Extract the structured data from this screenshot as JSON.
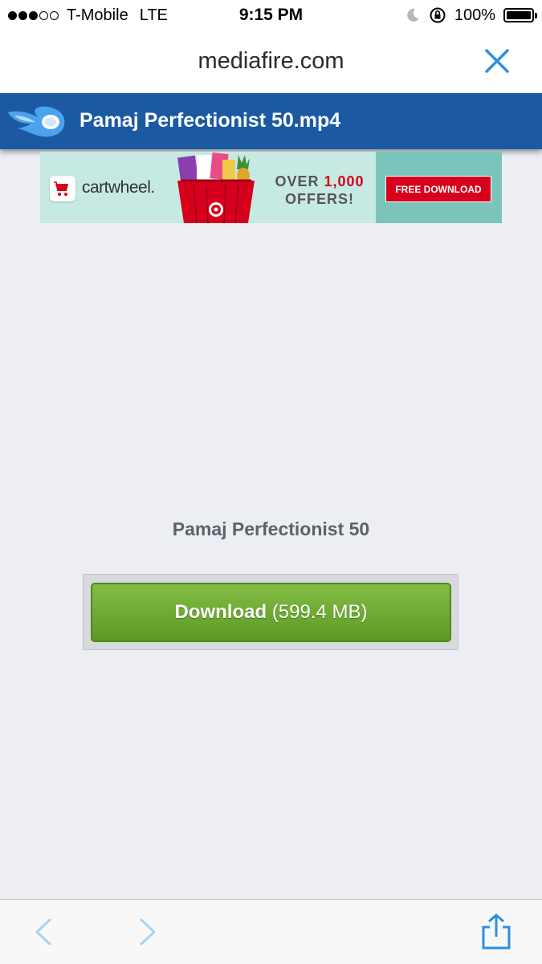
{
  "status_bar": {
    "carrier": "T-Mobile",
    "network": "LTE",
    "time": "9:15 PM",
    "battery": "100%",
    "signal_bars_filled": 3,
    "signal_bars_total": 5
  },
  "browser": {
    "url": "mediafire.com",
    "close_icon": "close-icon"
  },
  "header": {
    "logo_icon": "mediafire-logo-icon",
    "title": "Pamaj Perfectionist 50.mp4",
    "color": "#1b5aa3"
  },
  "ad": {
    "brand": "cartwheel.",
    "offer_line1_prefix": "OVER",
    "offer_line1_number": "1,000",
    "offer_line2": "OFFERS!",
    "cta": "FREE DOWNLOAD"
  },
  "main": {
    "file_name": "Pamaj Perfectionist 50",
    "download_label": "Download",
    "download_size": "(599.4 MB)",
    "button_color": "#6ea934"
  },
  "toolbar": {
    "back_icon": "chevron-left-icon",
    "forward_icon": "chevron-right-icon",
    "share_icon": "share-icon",
    "accent": "#2e8fe0"
  }
}
